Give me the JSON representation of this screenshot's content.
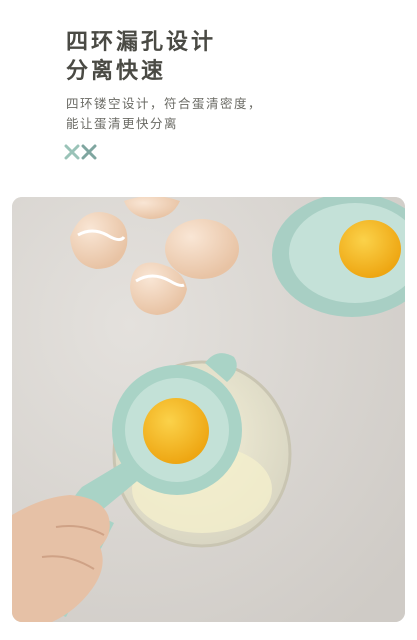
{
  "headline": {
    "line1": "四环漏孔设计",
    "line2": "分离快速"
  },
  "description": {
    "line1": "四环镂空设计，符合蛋清密度，",
    "line2": "能让蛋清更快分离"
  },
  "decoration": {
    "icon": "double-x-leaf-icon",
    "colors": [
      "#9ac3b8",
      "#7fa6a0"
    ]
  },
  "photo": {
    "subject": "egg-separator-product-photo",
    "colors": {
      "background": "#d9d5d1",
      "separator": "#a9d3c6",
      "yolk": "#f3b21c",
      "eggshell": "#f2d4b9"
    }
  }
}
